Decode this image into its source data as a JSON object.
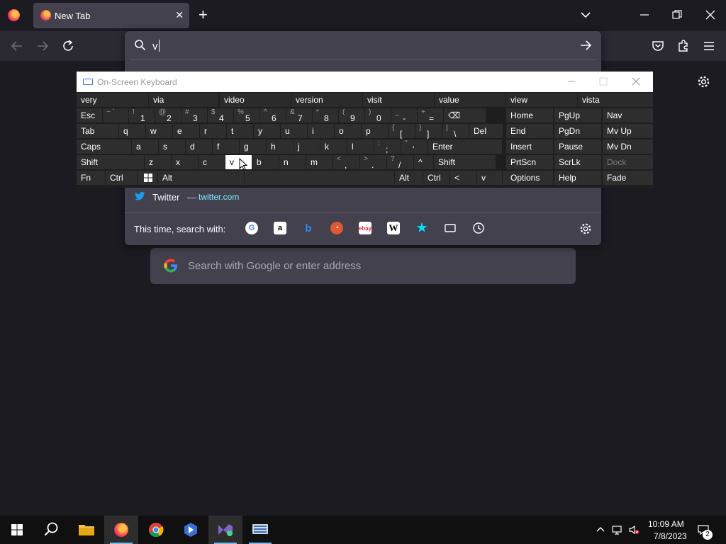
{
  "browser": {
    "tab_title": "New Tab",
    "tab_close": "✕",
    "new_tab": "+"
  },
  "urlbar": {
    "typed": "v",
    "suggestion": {
      "title": "Twitter",
      "separator": "—",
      "url": "twitter.com"
    },
    "engines_label": "This time, search with:",
    "engines": [
      "google-icon",
      "amazon-icon",
      "bing-icon",
      "duckduckgo-icon",
      "ebay-icon",
      "wikipedia-icon",
      "bookmarks-icon",
      "tabs-icon",
      "history-icon"
    ]
  },
  "newtab": {
    "search_placeholder": "Search with Google or enter address"
  },
  "osk": {
    "title": "On-Screen Keyboard",
    "predictions": [
      "very",
      "via",
      "video",
      "version",
      "visit",
      "value",
      "view",
      "vista"
    ],
    "row1": [
      {
        "main": "Esc"
      },
      {
        "sub": "~ `",
        "dig": ""
      },
      {
        "sub": "!",
        "dig": "1"
      },
      {
        "sub": "@",
        "dig": "2"
      },
      {
        "sub": "#",
        "dig": "3"
      },
      {
        "sub": "$",
        "dig": "4"
      },
      {
        "sub": "%",
        "dig": "5"
      },
      {
        "sub": "^",
        "dig": "6"
      },
      {
        "sub": "&",
        "dig": "7"
      },
      {
        "sub": "*",
        "dig": "8"
      },
      {
        "sub": "(",
        "dig": "9"
      },
      {
        "sub": ")",
        "dig": "0"
      },
      {
        "sub": "_",
        "dig": "-"
      },
      {
        "sub": "+",
        "dig": "="
      },
      {
        "main": "⌫"
      }
    ],
    "row2": [
      "Tab",
      "q",
      "w",
      "e",
      "r",
      "t",
      "y",
      "u",
      "i",
      "o",
      "p",
      "[",
      "]",
      "\\",
      "Del"
    ],
    "row2_subs": {
      "[": "{",
      "]": "}",
      "\\": "|"
    },
    "row3": [
      "Caps",
      "a",
      "s",
      "d",
      "f",
      "g",
      "h",
      "j",
      "k",
      "l",
      ";",
      "'",
      "Enter"
    ],
    "row3_subs": {
      ";": ":",
      "'": "\""
    },
    "row4": [
      "Shift",
      "z",
      "x",
      "c",
      "v",
      "b",
      "n",
      "m",
      ",",
      ".",
      "/",
      "^",
      "Shift"
    ],
    "row4_subs": {
      ",": "<",
      ".": ">",
      "/": "?"
    },
    "row5": [
      "Fn",
      "Ctrl",
      "win-icon",
      "Alt",
      "",
      "Alt",
      "Ctrl",
      "<",
      "v",
      ">",
      "menu-icon"
    ],
    "nav_keys": [
      [
        "Home",
        "PgUp",
        "Nav"
      ],
      [
        "End",
        "PgDn",
        "Mv Up"
      ],
      [
        "Insert",
        "Pause",
        "Mv Dn"
      ],
      [
        "PrtScn",
        "ScrLk",
        "Dock"
      ],
      [
        "Options",
        "Help",
        "Fade"
      ]
    ]
  },
  "taskbar": {
    "time": "10:09 AM",
    "date": "7/8/2023",
    "notifications": "2"
  },
  "colors": {
    "accent": "#76b9ed",
    "link": "#80ebff",
    "osk_bg": "#1e1e1e"
  }
}
